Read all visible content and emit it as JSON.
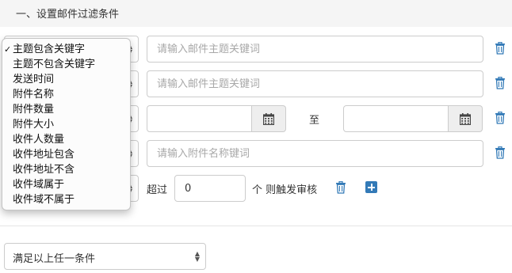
{
  "section": {
    "title": "一、设置邮件过滤条件"
  },
  "dropdown": {
    "selected_index": 0,
    "check_glyph": "✓",
    "options": [
      "主题包含关键字",
      "主题不包含关键字",
      "发送时间",
      "附件名称",
      "附件数量",
      "附件大小",
      "收件人数量",
      "收件地址包含",
      "收件地址不含",
      "收件域属于",
      "收件域不属于"
    ]
  },
  "rows": {
    "row1": {
      "placeholder": "请输入邮件主题关键词"
    },
    "row2": {
      "placeholder": "请输入邮件主题关键词"
    },
    "row3": {
      "to_label": "至"
    },
    "row4": {
      "placeholder": "请输入附件名称键词"
    },
    "row5": {
      "exceed_label": "超过",
      "count_value": "0",
      "trigger_label": "个 则触发审核"
    }
  },
  "footer": {
    "match_select_value": "满足以上任一条件"
  },
  "icons": {
    "trash": "trash-icon",
    "calendar": "calendar-icon",
    "plus": "plus-icon",
    "select_arrows": "select-arrows-icon"
  },
  "colors": {
    "accent": "#337ab7",
    "border": "#cccccc",
    "header_bg": "#f5f5f5",
    "addon_bg": "#eeeeee"
  }
}
